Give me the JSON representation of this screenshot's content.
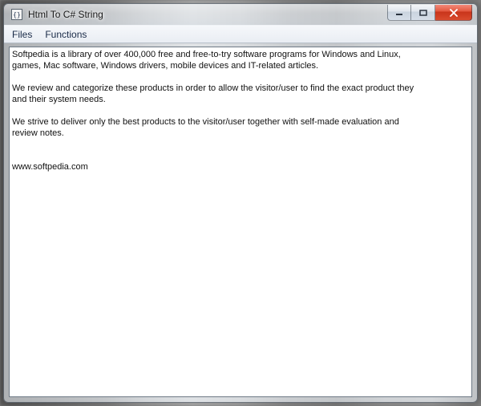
{
  "window": {
    "title": "Html To C# String"
  },
  "menubar": {
    "items": [
      {
        "label": "Files"
      },
      {
        "label": "Functions"
      }
    ]
  },
  "editor": {
    "content": "Softpedia is a library of over 400,000 free and free-to-try software programs for Windows and Linux,\ngames, Mac software, Windows drivers, mobile devices and IT-related articles.\n\nWe review and categorize these products in order to allow the visitor/user to find the exact product they\nand their system needs.\n\nWe strive to deliver only the best products to the visitor/user together with self-made evaluation and\nreview notes.\n\n\nwww.softpedia.com\n"
  }
}
